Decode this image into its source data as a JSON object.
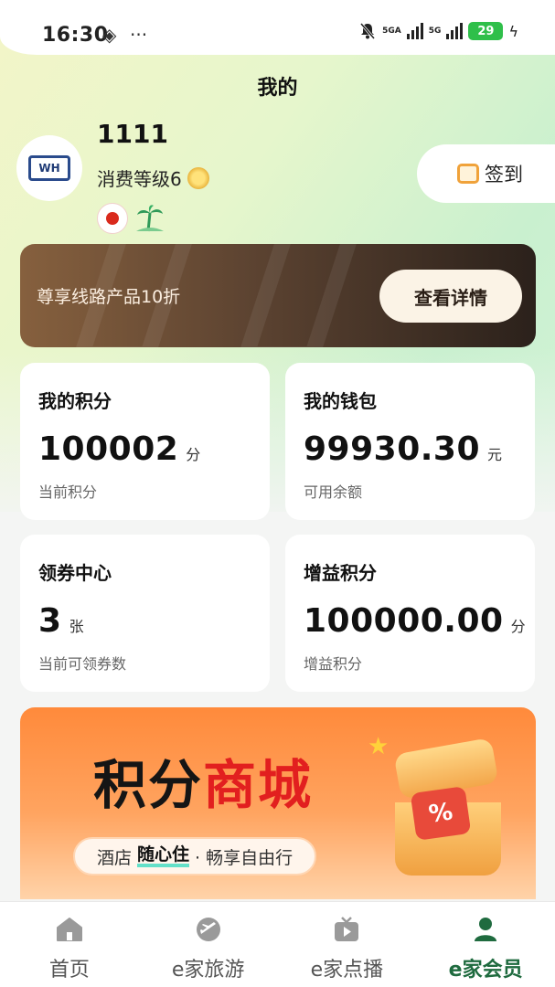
{
  "status_bar": {
    "time": "16:30",
    "network_1": "5GA",
    "network_2": "5G",
    "battery": "29"
  },
  "header": {
    "title": "我的"
  },
  "profile": {
    "username": "1111",
    "level": "消费等级6"
  },
  "signin": {
    "label": "签到"
  },
  "vip_banner": {
    "text": "尊享线路产品10折",
    "button": "查看详情"
  },
  "cards": [
    {
      "title": "我的积分",
      "value": "100002",
      "unit": "分",
      "sub": "当前积分"
    },
    {
      "title": "我的钱包",
      "value": "99930.30",
      "unit": "元",
      "sub": "可用余额"
    },
    {
      "title": "领券中心",
      "value": "3",
      "unit": "张",
      "sub": "当前可领券数"
    },
    {
      "title": "增益积分",
      "value": "100000.00",
      "unit": "分",
      "sub": "增益积分"
    }
  ],
  "promo": {
    "title_black": "积分",
    "title_red": "商城",
    "sub_prefix": "酒店",
    "sub_highlight": "随心住",
    "sub_suffix": "· 畅享自由行"
  },
  "tabbar": {
    "items": [
      {
        "label": "首页",
        "icon": "home-icon"
      },
      {
        "label": "e家旅游",
        "icon": "travel-icon"
      },
      {
        "label": "e家点播",
        "icon": "video-icon"
      },
      {
        "label": "e家会员",
        "icon": "member-icon"
      }
    ],
    "active_index": 3
  },
  "colors": {
    "accent_green": "#1f6b3f",
    "promo_red": "#e21f1f",
    "banner_dark": "#2b211b"
  }
}
